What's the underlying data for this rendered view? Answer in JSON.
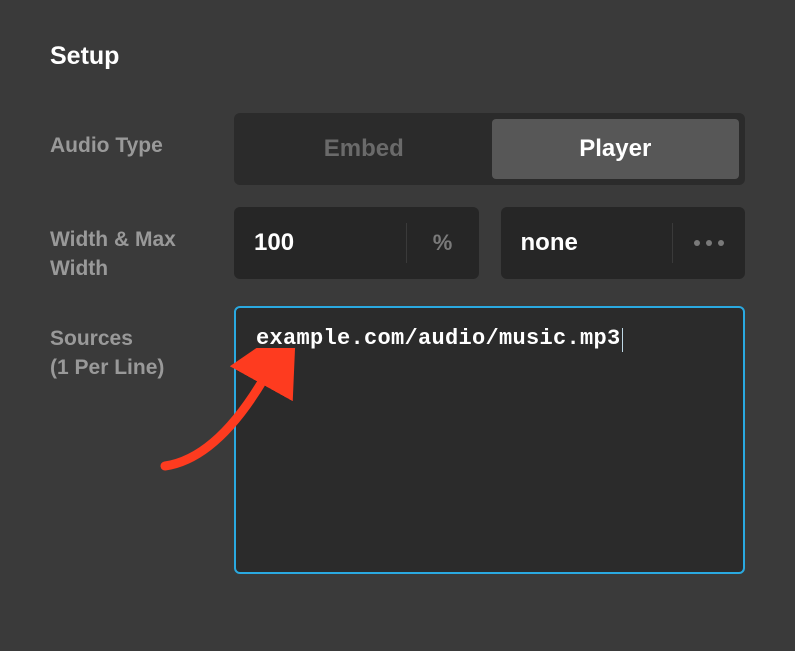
{
  "section_title": "Setup",
  "labels": {
    "audio_type": "Audio Type",
    "width_max_width": "Width & Max\nWidth",
    "sources": "Sources\n(1 Per Line)"
  },
  "audio_type": {
    "embed": "Embed",
    "player": "Player",
    "selected": "Player"
  },
  "width": {
    "value": "100",
    "unit": "%"
  },
  "max_width": {
    "value": "none"
  },
  "sources_value": "example.com/audio/music.mp3"
}
